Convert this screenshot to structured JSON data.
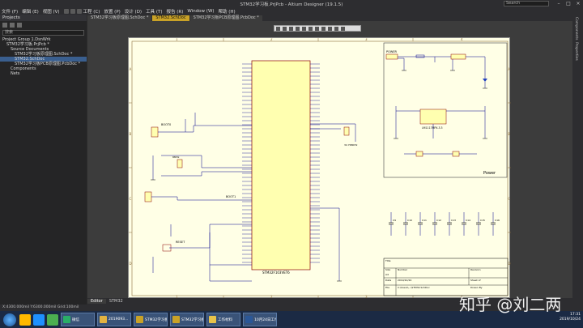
{
  "window": {
    "title": "STM32学习板.PrjPcb - Altium Designer (19.1.5)",
    "search_placeholder": "Search"
  },
  "menu": [
    "文件 (F)",
    "编辑 (E)",
    "视图 (V)",
    "工程 (C)",
    "放置 (P)",
    "设计 (D)",
    "工具 (T)",
    "报告 (R)",
    "Window (W)",
    "帮助 (H)"
  ],
  "doc_tabs": [
    {
      "label": "STM32学习板原理图.SchDoc *",
      "active": false
    },
    {
      "label": "STM32.SchDoc",
      "active": true
    },
    {
      "label": "STM32学习板PCB原理图.PcbDoc *",
      "active": false
    }
  ],
  "projects_panel": {
    "title": "Projects",
    "search_placeholder": "搜索",
    "tree": [
      {
        "label": "Project Group 1.DsnWrk",
        "selected": false,
        "indent": 0
      },
      {
        "label": "STM32学习板.PrjPcb *",
        "selected": false,
        "indent": 1
      },
      {
        "label": "Source Documents",
        "selected": false,
        "indent": 2
      },
      {
        "label": "STM32学习板原理图.SchDoc *",
        "selected": false,
        "indent": 3
      },
      {
        "label": "STM32.SchDoc",
        "selected": true,
        "indent": 3
      },
      {
        "label": "STM32学习板PCB原理图.PcbDoc *",
        "selected": false,
        "indent": 3
      },
      {
        "label": "Components",
        "selected": false,
        "indent": 2
      },
      {
        "label": "Nets",
        "selected": false,
        "indent": 2
      }
    ]
  },
  "right_panels": [
    "Components",
    "Properties"
  ],
  "schematic": {
    "mcu_label": "STM32F103VET6",
    "power_section_label": "Power",
    "boot0": "BOOT0",
    "boot1": "BOOT1",
    "reset": "RESET",
    "crystal_a": "8MHz",
    "crystal_b": "32.768KHz",
    "title_block": {
      "title_label": "Title",
      "size_label": "Size",
      "size": "A4",
      "number_label": "Number",
      "revision_label": "Revision",
      "date_label": "Date",
      "date": "2019/10/24",
      "file_label": "File",
      "file": "C:\\Users\\...\\STM32.SchDoc",
      "sheet_label": "Sheet of",
      "drawn_label": "Drawn By"
    },
    "col_labels": [
      "1",
      "2",
      "3",
      "4"
    ],
    "row_labels": [
      "A",
      "B",
      "C",
      "D"
    ],
    "regulator": "LM1117MPX-3.3",
    "usb_label": "POWER",
    "decoupling_caps": [
      "C9",
      "C10",
      "C11",
      "C12",
      "C13",
      "C14",
      "C15",
      "C16"
    ]
  },
  "bottom_tabs": [
    "Editor",
    "STM32"
  ],
  "status": "X:4300.000mil Y:6300.000mil   Grid:100mil",
  "taskbar": {
    "apps": [
      {
        "label": "微信",
        "color": "#2aae67"
      },
      {
        "label": "2019093...",
        "color": "#e3b341"
      },
      {
        "label": "STM32学习板.P...",
        "color": "#c9a227"
      },
      {
        "label": "STM32学习板.P...",
        "color": "#c9a227"
      },
      {
        "label": "工作材料",
        "color": "#e8c34a"
      },
      {
        "label": "10月24日工作...",
        "color": "#2b5797"
      }
    ],
    "time": "17:31",
    "date": "2019/10/24"
  },
  "watermark": "知乎 @刘二两"
}
